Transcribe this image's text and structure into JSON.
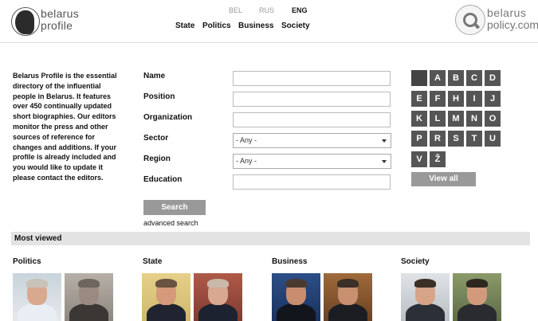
{
  "header": {
    "logo": {
      "line1": "belarus",
      "line2": "profile"
    },
    "languages": [
      {
        "label": "BEL",
        "active": false
      },
      {
        "label": "RUS",
        "active": false
      },
      {
        "label": "ENG",
        "active": true
      }
    ],
    "nav": [
      "State",
      "Politics",
      "Business",
      "Society"
    ],
    "partner_logo": {
      "line1": "belarus",
      "line2": "policy.com"
    }
  },
  "intro": "Belarus Profile is the essential directory of the influential people in Belarus. It features over 450 continually updated short biographies. Our editors monitor the press and other sources of reference for changes and additions. If your profile is already included and you would like to update it please contact the editors.",
  "form": {
    "name_label": "Name",
    "position_label": "Position",
    "organization_label": "Organization",
    "sector_label": "Sector",
    "sector_value": "- Any -",
    "region_label": "Region",
    "region_value": "- Any -",
    "education_label": "Education",
    "search_label": "Search",
    "advanced_label": "advanced search"
  },
  "alphabet": {
    "letters": [
      "",
      "A",
      "B",
      "C",
      "D",
      "E",
      "F",
      "H",
      "I",
      "J",
      "K",
      "L",
      "M",
      "N",
      "O",
      "P",
      "R",
      "S",
      "T",
      "U",
      "V",
      "Ž"
    ],
    "view_all": "View all"
  },
  "most_viewed": {
    "title": "Most viewed",
    "categories": [
      "Politics",
      "State",
      "Business",
      "Society"
    ]
  },
  "colors": {
    "tile": "#555555",
    "button": "#999999",
    "bar": "#e3e3e3"
  }
}
